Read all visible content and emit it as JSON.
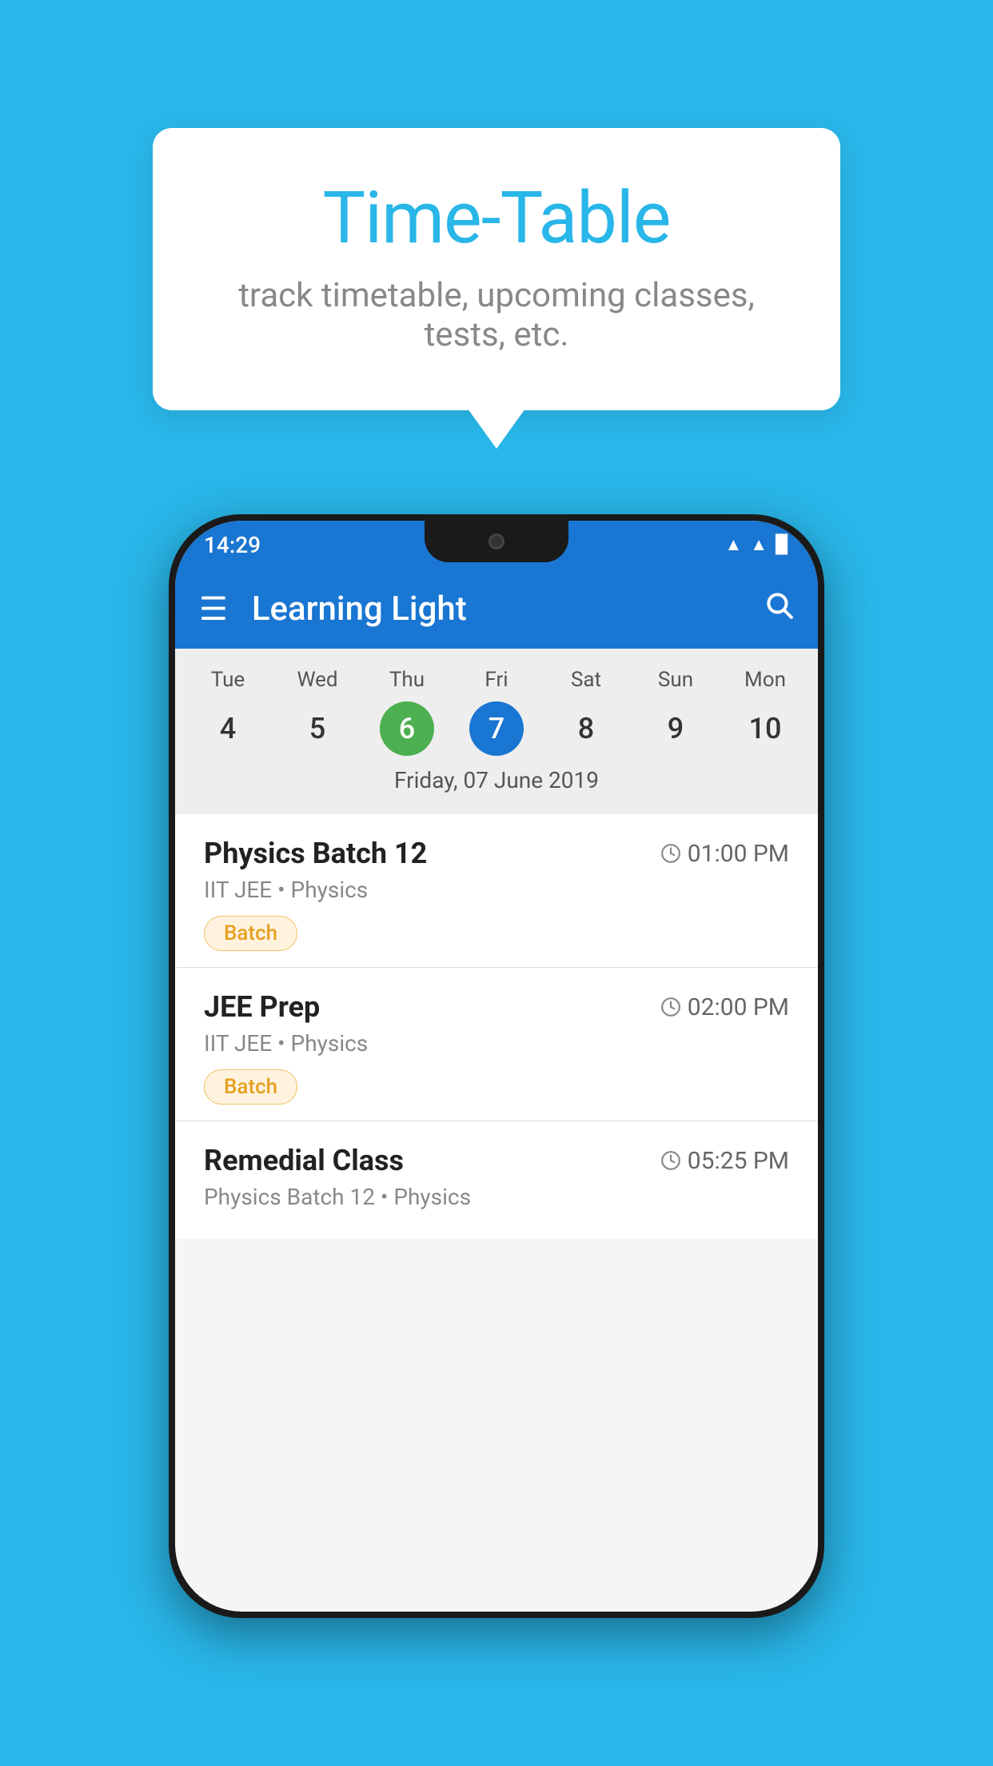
{
  "background_color": "#29b6e8",
  "speech_bubble": {
    "title": "Time-Table",
    "subtitle": "track timetable, upcoming classes, tests, etc."
  },
  "phone": {
    "status_bar": {
      "time": "14:29",
      "wifi": "▲",
      "signal": "▲",
      "battery": "▉"
    },
    "app_bar": {
      "menu_icon": "☰",
      "title": "Learning Light",
      "search_icon": "🔍"
    },
    "calendar": {
      "days": [
        "Tue",
        "Wed",
        "Thu",
        "Fri",
        "Sat",
        "Sun",
        "Mon"
      ],
      "dates": [
        "4",
        "5",
        "6",
        "7",
        "8",
        "9",
        "10"
      ],
      "today_index": 2,
      "selected_index": 3,
      "selected_label": "Friday, 07 June 2019"
    },
    "classes": [
      {
        "name": "Physics Batch 12",
        "time": "01:00 PM",
        "subtitle": "IIT JEE • Physics",
        "badge": "Batch"
      },
      {
        "name": "JEE Prep",
        "time": "02:00 PM",
        "subtitle": "IIT JEE • Physics",
        "badge": "Batch"
      },
      {
        "name": "Remedial Class",
        "time": "05:25 PM",
        "subtitle": "Physics Batch 12 • Physics",
        "badge": ""
      }
    ]
  }
}
